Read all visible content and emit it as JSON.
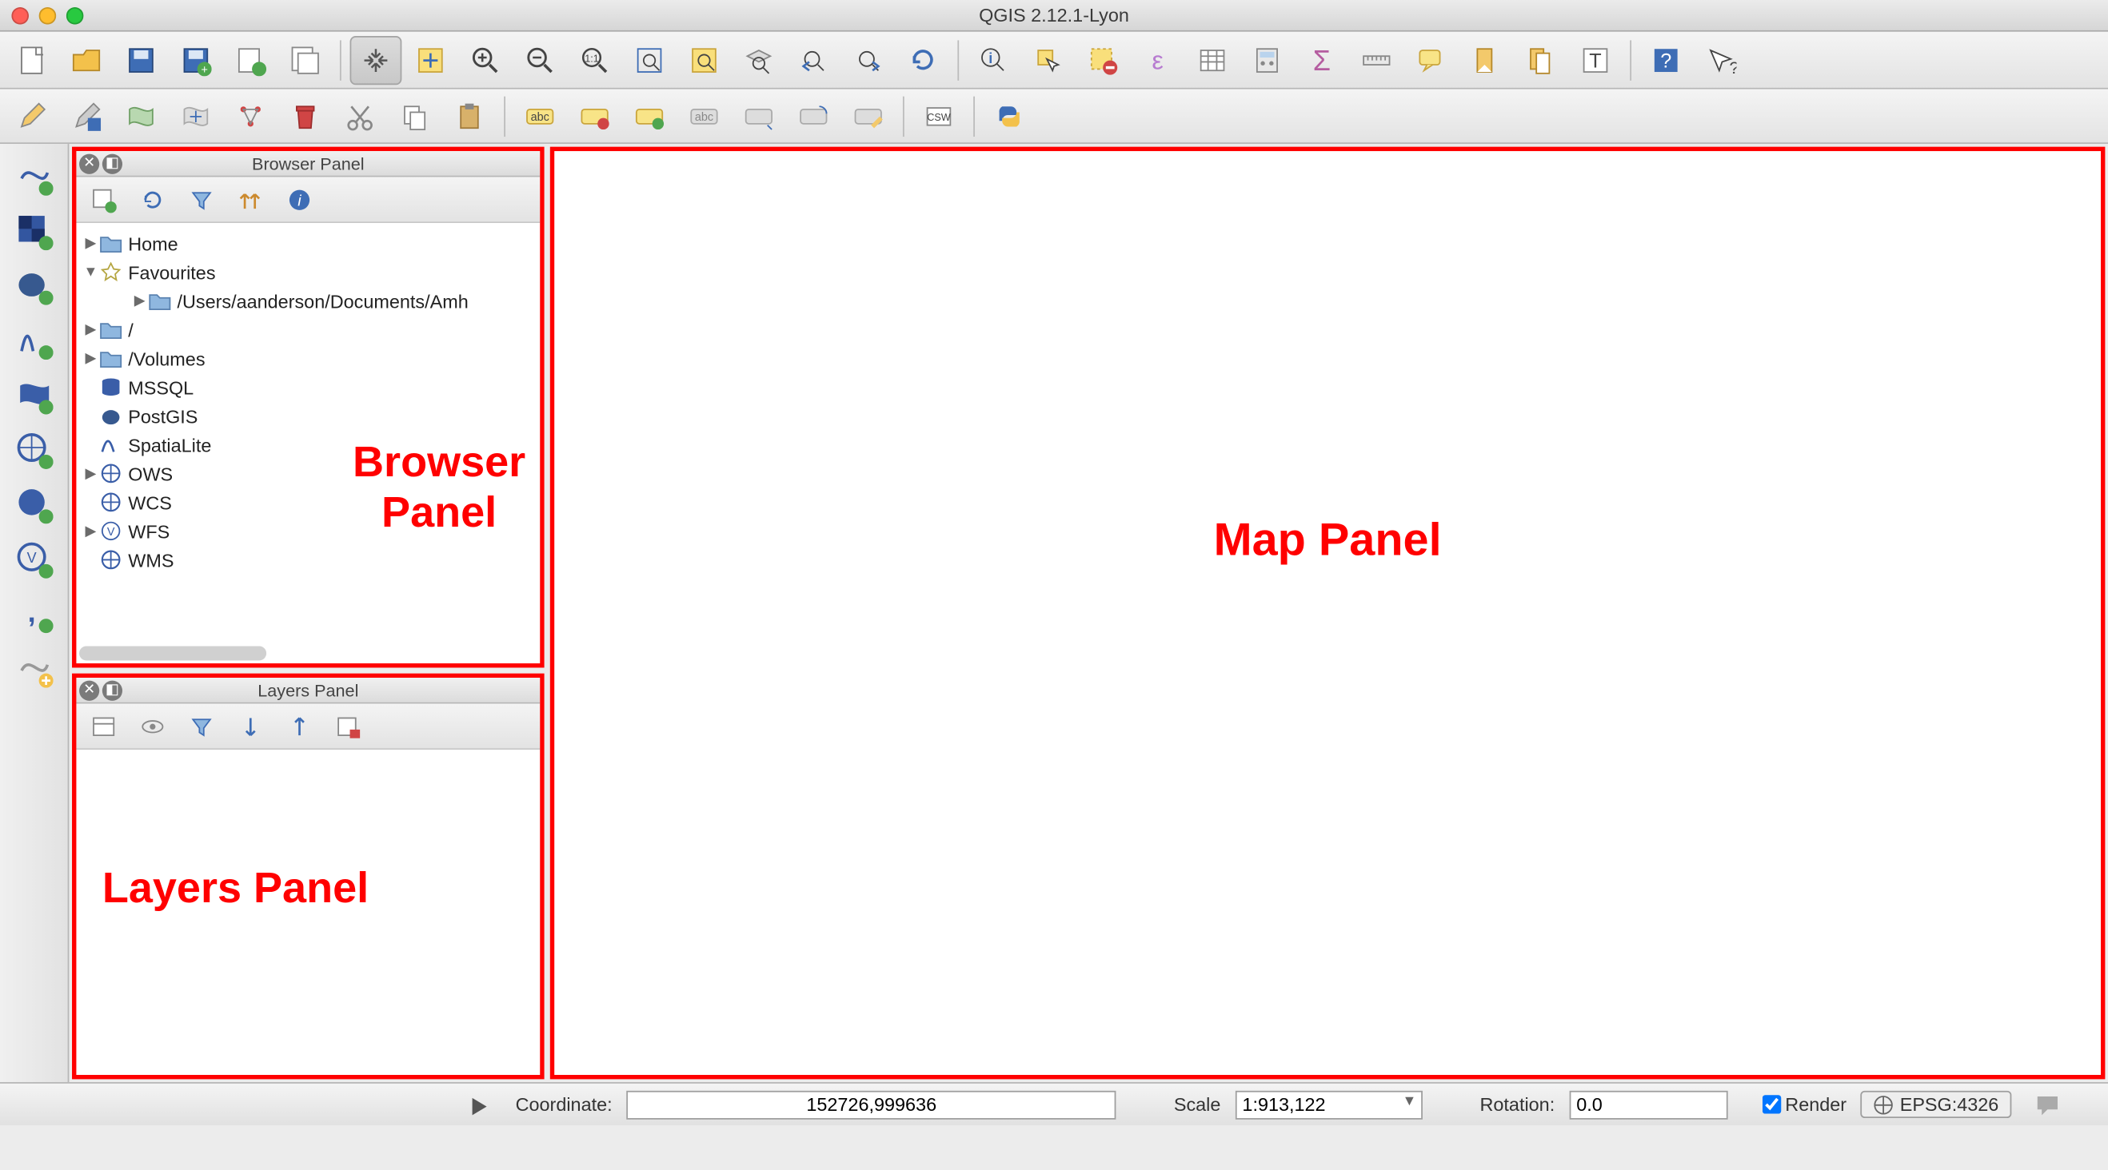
{
  "window": {
    "title": "QGIS 2.12.1-Lyon"
  },
  "panels": {
    "browser": {
      "title": "Browser Panel",
      "items": [
        {
          "label": "Home",
          "icon": "folder",
          "expand": "closed",
          "indent": 0
        },
        {
          "label": "Favourites",
          "icon": "star",
          "expand": "open",
          "indent": 0
        },
        {
          "label": "/Users/aanderson/Documents/Amh",
          "icon": "folder",
          "expand": "closed",
          "indent": 2
        },
        {
          "label": "/",
          "icon": "folder",
          "expand": "closed",
          "indent": 0
        },
        {
          "label": "/Volumes",
          "icon": "folder",
          "expand": "closed",
          "indent": 0
        },
        {
          "label": "MSSQL",
          "icon": "db",
          "expand": "none",
          "indent": 0
        },
        {
          "label": "PostGIS",
          "icon": "elephant",
          "expand": "none",
          "indent": 0
        },
        {
          "label": "SpatiaLite",
          "icon": "feather",
          "expand": "none",
          "indent": 0
        },
        {
          "label": "OWS",
          "icon": "globe",
          "expand": "closed",
          "indent": 0
        },
        {
          "label": "WCS",
          "icon": "globe",
          "expand": "none",
          "indent": 0
        },
        {
          "label": "WFS",
          "icon": "wfs",
          "expand": "closed",
          "indent": 0
        },
        {
          "label": "WMS",
          "icon": "globe",
          "expand": "none",
          "indent": 0
        }
      ]
    },
    "layers": {
      "title": "Layers Panel"
    }
  },
  "annotations": {
    "browser_line1": "Browser",
    "browser_line2": "Panel",
    "layers": "Layers Panel",
    "map": "Map Panel"
  },
  "statusbar": {
    "coord_label": "Coordinate:",
    "coord_value": "152726,999636",
    "scale_label": "Scale",
    "scale_value": "1:913,122",
    "rotation_label": "Rotation:",
    "rotation_value": "0.0",
    "render_label": "Render",
    "crs_label": "EPSG:4326"
  }
}
